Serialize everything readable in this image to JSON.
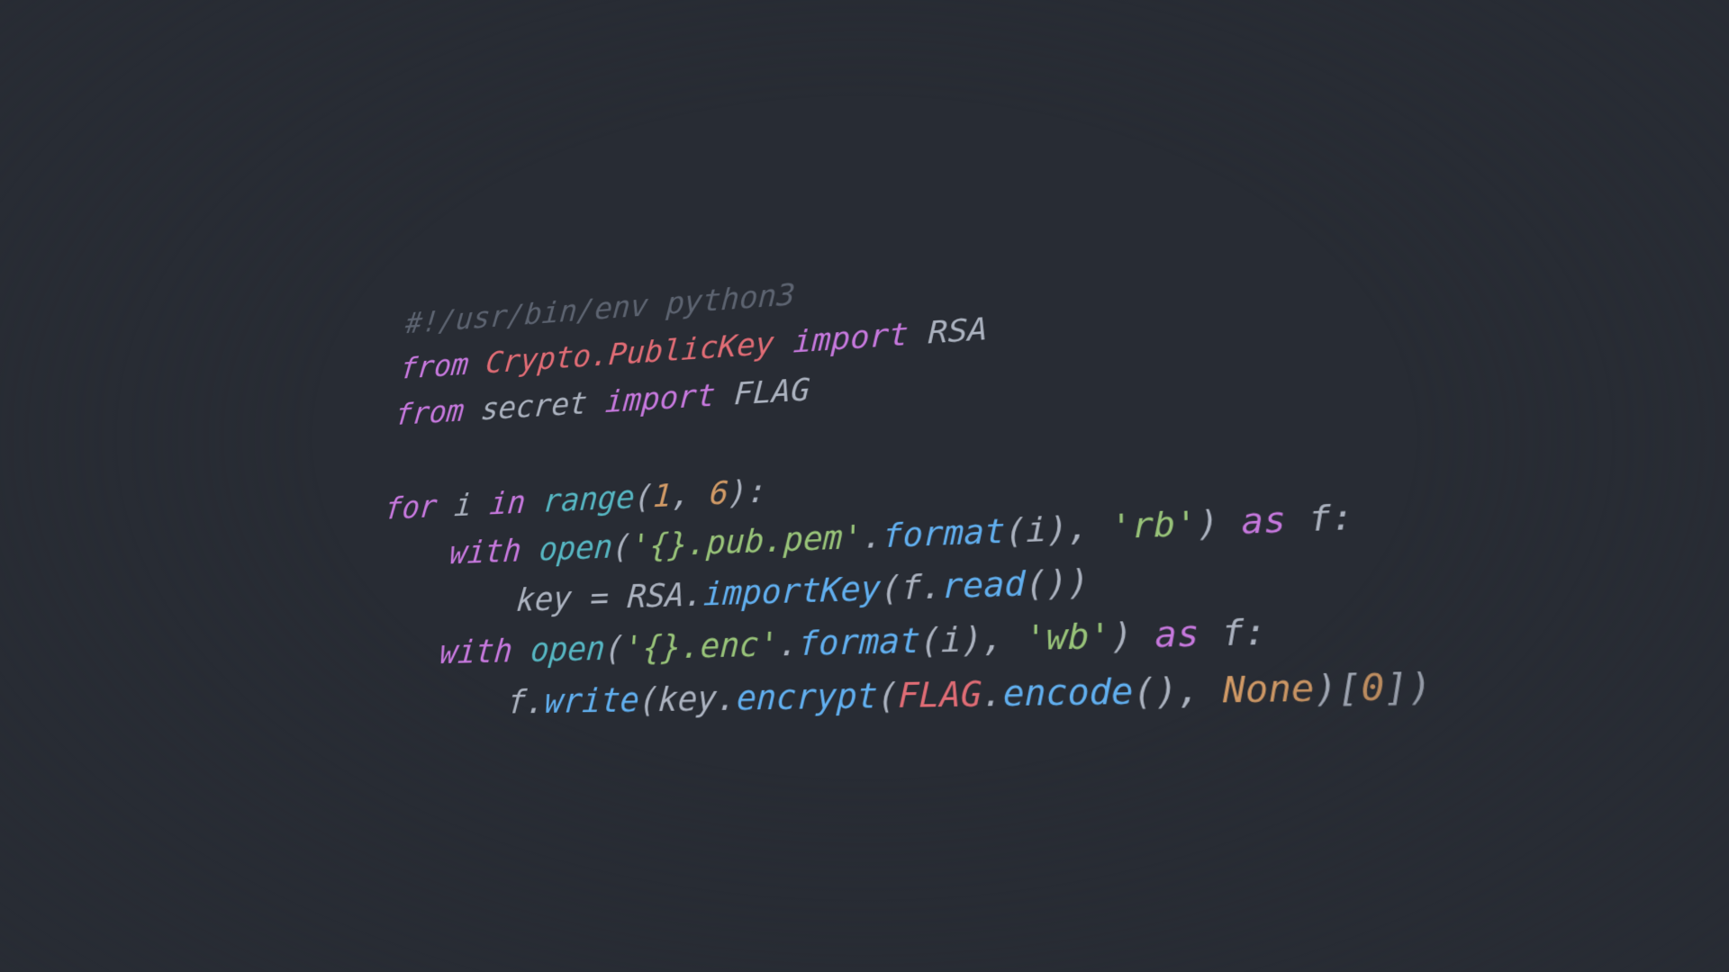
{
  "colors": {
    "background": "#282c34",
    "foreground": "#abb2bf",
    "comment": "#5c6370",
    "keyword": "#c678dd",
    "module": "#e06c75",
    "string": "#98c379",
    "number": "#d19a66",
    "constant": "#d19a66",
    "builtin": "#56b6c2",
    "function": "#61afef",
    "variable": "#e06c75"
  },
  "code": {
    "shebang": "#!/usr/bin/env python3",
    "kw_from_1": "from",
    "mod_crypto": "Crypto.PublicKey",
    "kw_import_1": "import",
    "sym_rsa": "RSA",
    "kw_from_2": "from",
    "mod_secret": "secret",
    "kw_import_2": "import",
    "sym_flag": "FLAG",
    "kw_for": "for",
    "var_i": "i",
    "kw_in": "in",
    "fn_range": "range",
    "lparen1": "(",
    "num_1": "1",
    "comma1": ", ",
    "num_6": "6",
    "rparen1": ")",
    "colon1": ":",
    "kw_with_1": "with",
    "fn_open_1": "open",
    "lparen2": "(",
    "str_pubpem": "'{}.pub.pem'",
    "dot1": ".",
    "fn_format_1": "format",
    "lparen3": "(",
    "arg_i_1": "i",
    "rparen3": ")",
    "comma2": ", ",
    "str_rb": "'rb'",
    "rparen2": ")",
    "kw_as_1": " as ",
    "var_f_1": "f",
    "colon2": ":",
    "var_key": "key",
    "eq": " = ",
    "cls_rsa": "RSA",
    "dot2": ".",
    "fn_importKey": "importKey",
    "lparen4": "(",
    "var_f_read": "f",
    "dot3": ".",
    "fn_read": "read",
    "lparen5": "(",
    "rparen5": ")",
    "rparen4": ")",
    "kw_with_2": "with",
    "fn_open_2": "open",
    "lparen6": "(",
    "str_enc": "'{}.enc'",
    "dot4": ".",
    "fn_format_2": "format",
    "lparen7": "(",
    "arg_i_2": "i",
    "rparen7": ")",
    "comma3": ", ",
    "str_wb": "'wb'",
    "rparen6": ")",
    "kw_as_2": " as ",
    "var_f_2": "f",
    "colon3": ":",
    "var_f_write": "f",
    "dot5": ".",
    "fn_write": "write",
    "lparen8": "(",
    "var_key2": "key",
    "dot6": ".",
    "fn_encrypt": "encrypt",
    "lparen9": "(",
    "sym_flag2": "FLAG",
    "dot7": ".",
    "fn_encode": "encode",
    "lparen10": "(",
    "rparen10": ")",
    "comma4": ", ",
    "const_none": "None",
    "rparen9": ")",
    "lbrack": "[",
    "num_0": "0",
    "rbrack": "]",
    "rparen8": ")"
  }
}
